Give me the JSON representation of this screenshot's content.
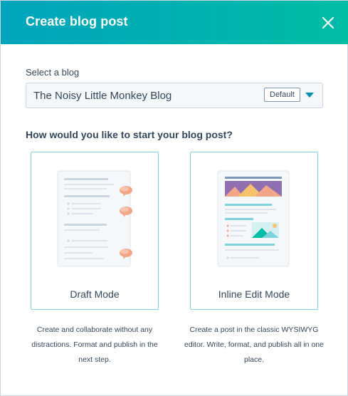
{
  "header": {
    "title": "Create blog post",
    "close_icon": "close-icon"
  },
  "blog_select": {
    "label": "Select a blog",
    "value": "The Noisy Little Monkey Blog",
    "badge": "Default",
    "icon": "caret-down-icon"
  },
  "question": "How would you like to start your blog post?",
  "modes": [
    {
      "label": "Draft Mode",
      "description": "Create and collaborate without any distractions. Format and publish in the next step.",
      "illustration": "draft-document-with-comments-icon"
    },
    {
      "label": "Inline Edit Mode",
      "description": "Create a post in the classic WYSIWYG editor. Write, format, and publish all in one place.",
      "illustration": "inline-edit-page-icon"
    }
  ],
  "colors": {
    "header_gradient_start": "#00a4bd",
    "header_gradient_end": "#00bda5",
    "card_border": "#7fd1de",
    "comment_bubble": "#f2a587",
    "text": "#33475b"
  }
}
